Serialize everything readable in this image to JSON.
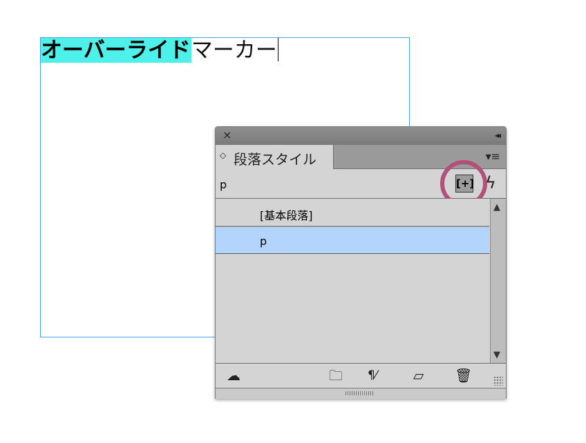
{
  "document": {
    "text_bold_highlighted": "オーバーライド",
    "text_normal": "マーカー"
  },
  "panel": {
    "close_glyph": "×",
    "collapse_glyph": "◂◂",
    "tab_label": "段落スタイル",
    "tab_arrows_glyph": "◇",
    "menu_glyph": "▾≡",
    "current_style": "p",
    "new_style_glyph": "[+]",
    "lightning_glyph": "ϟ",
    "items": [
      {
        "label": "[基本段落]",
        "selected": false
      },
      {
        "label": "p",
        "selected": true
      }
    ],
    "scroll_up_glyph": "▲",
    "scroll_down_glyph": "▼",
    "footer_icons": {
      "cloud": "☁",
      "folder": "🗀",
      "clear_override": "¶⁄",
      "new_page": "▱",
      "trash": "🗑"
    }
  },
  "colors": {
    "highlight": "#4ef0ea",
    "selection": "#b3d4fc",
    "annotation_ring": "#b2507a",
    "frame_border": "#3ea3e8"
  }
}
